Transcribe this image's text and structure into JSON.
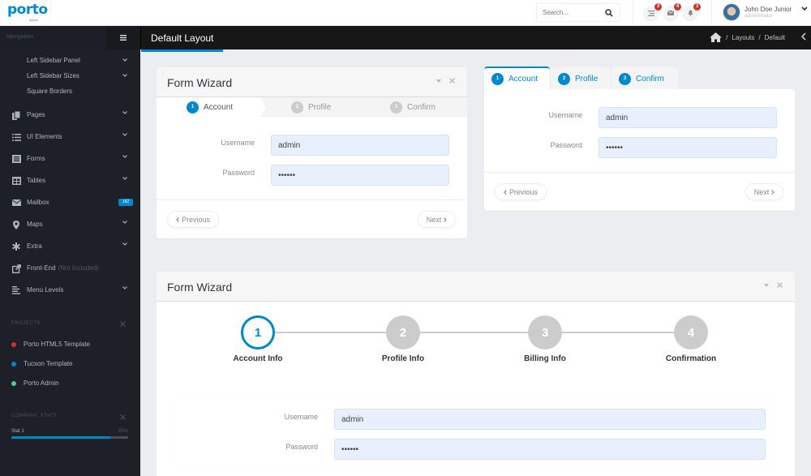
{
  "header": {
    "logo_text": "porto",
    "logo_sub": "admin",
    "search_placeholder": "Search...",
    "notifications": [
      {
        "icon": "tasks-icon",
        "count": "3"
      },
      {
        "icon": "envelope-icon",
        "count": "4"
      },
      {
        "icon": "bell-icon",
        "count": "3"
      }
    ],
    "user": {
      "name": "John Doe Junior",
      "role": "administrator"
    }
  },
  "sidebar": {
    "nav_label": "Navigation",
    "sub_items": [
      {
        "label": "Left Sidebar Panel",
        "has_children": true
      },
      {
        "label": "Left Sidebar Sizes",
        "has_children": true
      },
      {
        "label": "Square Borders",
        "has_children": false
      }
    ],
    "items": [
      {
        "label": "Pages",
        "icon": "copy-icon"
      },
      {
        "label": "UI Elements",
        "icon": "tasks-icon"
      },
      {
        "label": "Forms",
        "icon": "list-alt-icon"
      },
      {
        "label": "Tables",
        "icon": "table-icon"
      },
      {
        "label": "Mailbox",
        "icon": "envelope-icon",
        "badge": "182"
      },
      {
        "label": "Maps",
        "icon": "map-marker-icon"
      },
      {
        "label": "Extra",
        "icon": "asterisk-icon"
      },
      {
        "label": "Front-End",
        "muted": "(Not Included)",
        "icon": "external-link-icon"
      },
      {
        "label": "Menu Levels",
        "icon": "align-left-icon"
      }
    ],
    "projects": {
      "title": "Projects",
      "items": [
        {
          "label": "Porto HTML5 Template",
          "color": "#d2322d"
        },
        {
          "label": "Tucson Template",
          "color": "#0088cc"
        },
        {
          "label": "Porto Admin",
          "color": "#47a447"
        }
      ]
    },
    "company_stats": {
      "title": "Company Stats",
      "stats": [
        {
          "label": "Stat 1",
          "value": "85%",
          "percent": 85
        }
      ]
    }
  },
  "page": {
    "title": "Default Layout",
    "breadcrumbs": [
      "Layouts",
      "Default"
    ]
  },
  "wizard1": {
    "title": "Form Wizard",
    "steps": [
      {
        "num": "1",
        "label": "Account",
        "active": true
      },
      {
        "num": "2",
        "label": "Profile",
        "active": false
      },
      {
        "num": "3",
        "label": "Confirm",
        "active": false
      }
    ],
    "fields": [
      {
        "label": "Username",
        "value": "admin"
      },
      {
        "label": "Password",
        "value": "••••••"
      }
    ],
    "prev": "Previous",
    "next": "Next"
  },
  "wizard2": {
    "tabs": [
      {
        "num": "1",
        "label": "Account",
        "active": true
      },
      {
        "num": "2",
        "label": "Profile",
        "active": false
      },
      {
        "num": "3",
        "label": "Confirm",
        "active": false
      }
    ],
    "fields": [
      {
        "label": "Username",
        "value": "admin"
      },
      {
        "label": "Password",
        "value": "••••••"
      }
    ],
    "prev": "Previous",
    "next": "Next"
  },
  "wizard3": {
    "title": "Form Wizard",
    "steps": [
      {
        "num": "1",
        "label": "Account Info",
        "active": true
      },
      {
        "num": "2",
        "label": "Profile Info",
        "active": false
      },
      {
        "num": "3",
        "label": "Billing Info",
        "active": false
      },
      {
        "num": "4",
        "label": "Confirmation",
        "active": false
      }
    ],
    "fields": [
      {
        "label": "Username",
        "value": "admin"
      },
      {
        "label": "Password",
        "value": "••••••"
      }
    ]
  },
  "colors": {
    "accent": "#0088cc",
    "sidebar_bg": "#1d2127",
    "badge_red": "#d2322d"
  }
}
